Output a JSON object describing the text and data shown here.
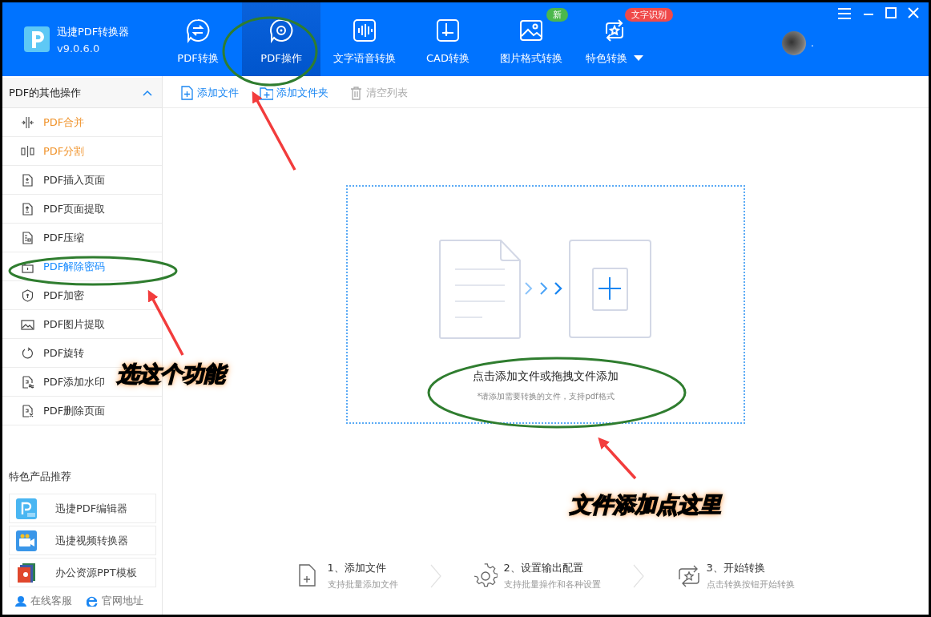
{
  "app": {
    "name": "迅捷PDF转换器",
    "version": "v9.0.6.0"
  },
  "nav_tabs": [
    {
      "label": "PDF转换",
      "selected": false
    },
    {
      "label": "PDF操作",
      "selected": true
    },
    {
      "label": "文字语音转换",
      "selected": false
    },
    {
      "label": "CAD转换",
      "selected": false
    },
    {
      "label": "图片格式转换",
      "selected": false,
      "badge": {
        "text": "新",
        "color": "#4cb84c"
      }
    },
    {
      "label": "特色转换",
      "selected": false,
      "dropdown": true,
      "badge": {
        "text": "文字识别",
        "color": "#f04a4a"
      }
    }
  ],
  "user": {
    "name": "."
  },
  "sidebar": {
    "title": "PDF的其他操作",
    "expanded": true,
    "items": [
      {
        "label": "PDF合并",
        "kind": "hot",
        "selected": false
      },
      {
        "label": "PDF分割",
        "kind": "hot",
        "selected": false
      },
      {
        "label": "PDF插入页面",
        "kind": "normal",
        "selected": false
      },
      {
        "label": "PDF页面提取",
        "kind": "normal",
        "selected": false
      },
      {
        "label": "PDF压缩",
        "kind": "normal",
        "selected": false
      },
      {
        "label": "PDF解除密码",
        "kind": "normal",
        "selected": true
      },
      {
        "label": "PDF加密",
        "kind": "normal",
        "selected": false
      },
      {
        "label": "PDF图片提取",
        "kind": "normal",
        "selected": false
      },
      {
        "label": "PDF旋转",
        "kind": "normal",
        "selected": false
      },
      {
        "label": "PDF添加水印",
        "kind": "normal",
        "selected": false
      },
      {
        "label": "PDF删除页面",
        "kind": "normal",
        "selected": false
      }
    ]
  },
  "toolbar": [
    {
      "label": "添加文件",
      "disabled": false
    },
    {
      "label": "添加文件夹",
      "disabled": false
    },
    {
      "label": "清空列表",
      "disabled": true
    }
  ],
  "drop_zone": {
    "title": "点击添加文件或拖拽文件添加",
    "hint": "*请添加需要转换的文件，支持pdf格式"
  },
  "steps": [
    {
      "title": "1、添加文件",
      "subtitle": "支持批量添加文件"
    },
    {
      "title": "2、设置输出配置",
      "subtitle": "支持批量操作和各种设置"
    },
    {
      "title": "3、开始转换",
      "subtitle": "点击转换按钮开始转换"
    }
  ],
  "recommended": {
    "title": "特色产品推荐",
    "items": [
      "迅捷PDF编辑器",
      "迅捷视频转换器",
      "办公资源PPT模板"
    ]
  },
  "footer_links": [
    "在线客服",
    "官网地址"
  ],
  "annotations": [
    {
      "text": "选这个功能"
    },
    {
      "text": "文件添加点这里"
    }
  ]
}
